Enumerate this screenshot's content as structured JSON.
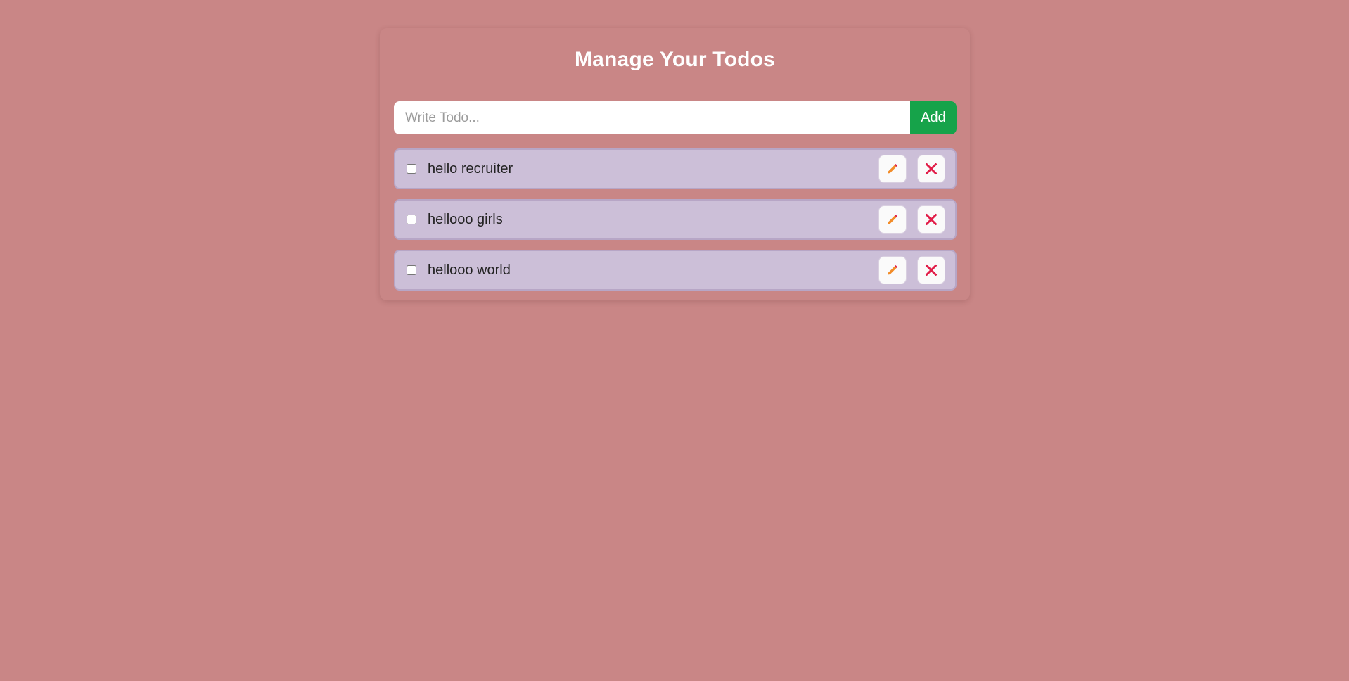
{
  "header": {
    "title": "Manage Your Todos"
  },
  "add_form": {
    "placeholder": "Write Todo...",
    "value": "",
    "add_label": "Add"
  },
  "todos": [
    {
      "text": "hello recruiter",
      "completed": false
    },
    {
      "text": "hellooo girls",
      "completed": false
    },
    {
      "text": "hellooo world",
      "completed": false
    }
  ],
  "icons": {
    "edit": "pencil-icon",
    "delete": "close-icon"
  },
  "colors": {
    "background": "#c98686",
    "item_background": "#ccbfd8",
    "add_button": "#16a34a",
    "edit_icon": "#f28c28",
    "delete_icon": "#e11d48"
  }
}
